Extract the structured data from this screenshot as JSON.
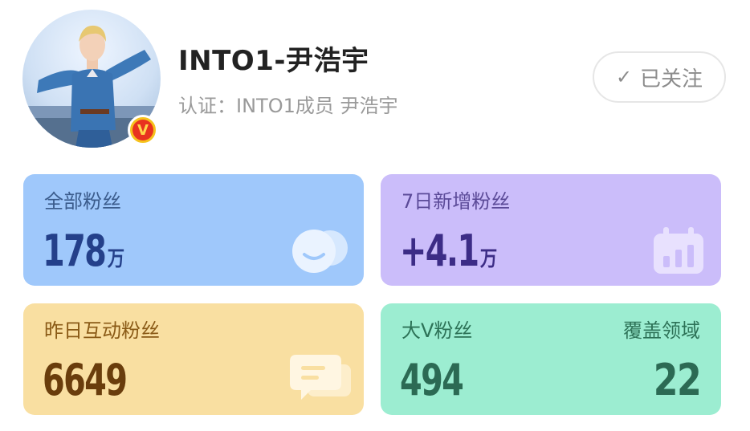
{
  "profile": {
    "name": "INTO1-尹浩宇",
    "verification": "认证：INTO1成员 尹浩宇",
    "badge_letter": "V",
    "follow_label": "已关注"
  },
  "stats": {
    "total_fans": {
      "label": "全部粉丝",
      "value": "178",
      "unit": "万"
    },
    "new_fans_7d": {
      "label": "7日新增粉丝",
      "value": "+4.1",
      "unit": "万"
    },
    "interactive_fans_yesterday": {
      "label": "昨日互动粉丝",
      "value": "6649"
    },
    "big_v_fans": {
      "label": "大V粉丝",
      "value": "494",
      "coverage_label": "覆盖领域",
      "coverage_value": "22"
    }
  },
  "colors": {
    "card_total": "#9fc8fb",
    "card_new": "#cbbdfa",
    "card_interactive": "#f9dfa1",
    "card_bigv": "#9cedd1",
    "badge_red": "#e8331f",
    "badge_gold": "#f6c21c"
  },
  "icons": {
    "total_fans": "fans-faces-icon",
    "new_fans": "calendar-chart-icon",
    "interactive": "chat-bubble-icon",
    "follow": "check-icon"
  }
}
